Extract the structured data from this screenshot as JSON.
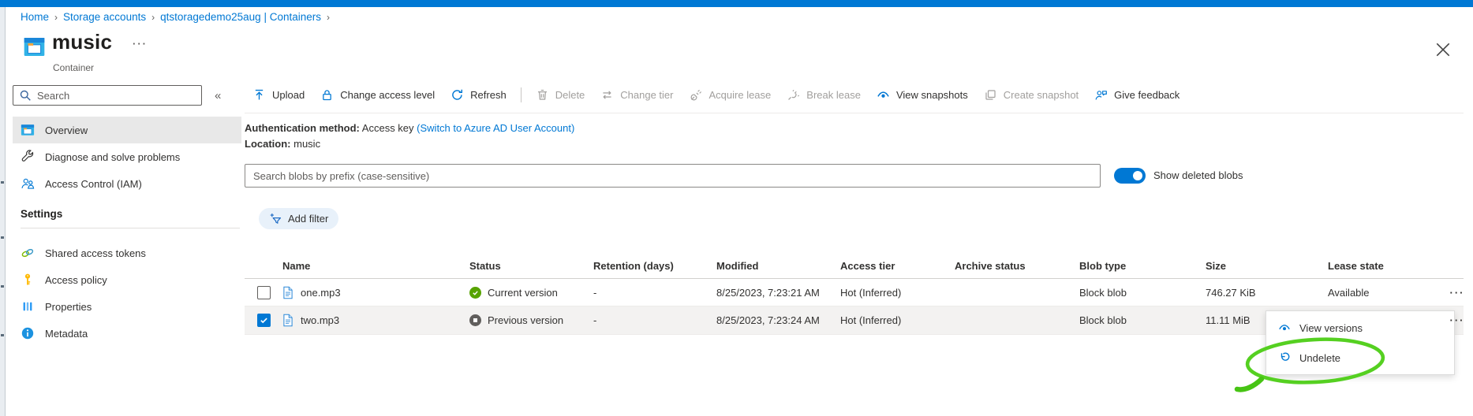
{
  "glyphs": {
    "collapse": "«",
    "ellipsis": "···",
    "breadcrumb_separator": "›",
    "retention_empty": "-"
  },
  "breadcrumb": {
    "items": [
      "Home",
      "Storage accounts",
      "qtstoragedemo25aug | Containers"
    ]
  },
  "header": {
    "title": "music",
    "subtitle": "Container"
  },
  "sidebar": {
    "search_placeholder": "Search",
    "items": [
      {
        "label": "Overview",
        "selected": true
      },
      {
        "label": "Diagnose and solve problems",
        "selected": false
      },
      {
        "label": "Access Control (IAM)",
        "selected": false
      }
    ],
    "section_title": "Settings",
    "settings_items": [
      {
        "label": "Shared access tokens"
      },
      {
        "label": "Access policy"
      },
      {
        "label": "Properties"
      },
      {
        "label": "Metadata"
      }
    ]
  },
  "toolbar": {
    "buttons": [
      {
        "label": "Upload",
        "enabled": true
      },
      {
        "label": "Change access level",
        "enabled": true
      },
      {
        "label": "Refresh",
        "enabled": true
      },
      {
        "label": "Delete",
        "enabled": false
      },
      {
        "label": "Change tier",
        "enabled": false
      },
      {
        "label": "Acquire lease",
        "enabled": false
      },
      {
        "label": "Break lease",
        "enabled": false
      },
      {
        "label": "View snapshots",
        "enabled": true
      },
      {
        "label": "Create snapshot",
        "enabled": false
      },
      {
        "label": "Give feedback",
        "enabled": true
      }
    ]
  },
  "info": {
    "auth_label": "Authentication method:",
    "auth_value": "Access key",
    "auth_link": "(Switch to Azure AD User Account)",
    "location_label": "Location:",
    "location_value": "music"
  },
  "filterbar": {
    "search_placeholder": "Search blobs by prefix (case-sensitive)",
    "toggle_label": "Show deleted blobs",
    "toggle_on": true,
    "add_filter_label": "Add filter"
  },
  "table": {
    "columns": [
      "Name",
      "Status",
      "Retention (days)",
      "Modified",
      "Access tier",
      "Archive status",
      "Blob type",
      "Size",
      "Lease state"
    ],
    "rows": [
      {
        "name": "one.mp3",
        "status": "Current version",
        "status_kind": "current",
        "retention": "-",
        "modified": "8/25/2023, 7:23:21 AM",
        "access_tier": "Hot (Inferred)",
        "archive_status": "",
        "blob_type": "Block blob",
        "size": "746.27 KiB",
        "lease_state": "Available",
        "checked": false
      },
      {
        "name": "two.mp3",
        "status": "Previous version",
        "status_kind": "previous",
        "retention": "-",
        "modified": "8/25/2023, 7:23:24 AM",
        "access_tier": "Hot (Inferred)",
        "archive_status": "",
        "blob_type": "Block blob",
        "size": "11.11 MiB",
        "lease_state": "",
        "checked": true
      }
    ]
  },
  "context_menu": {
    "items": [
      {
        "label": "View versions"
      },
      {
        "label": "Undelete",
        "annotated": true
      }
    ]
  },
  "colors": {
    "accent": "#0078d4",
    "status_current_green": "#57a300",
    "status_previous_gray": "#605e5c",
    "selected_row_bg": "#f3f2f1",
    "annotation_green": "#55d021",
    "disabled_text": "#a19f9d"
  }
}
